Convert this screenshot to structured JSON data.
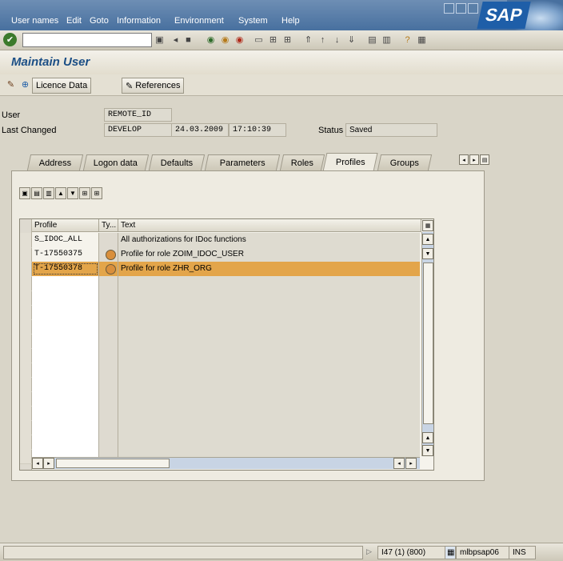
{
  "menu": {
    "items": [
      "User names",
      "Edit",
      "Goto",
      "Information",
      "Environment",
      "System",
      "Help"
    ],
    "logo": "SAP"
  },
  "toolbar": {
    "ok_symbol": "✔"
  },
  "screen": {
    "title": "Maintain User",
    "app_buttons": {
      "licence": "Licence Data",
      "references": "References"
    }
  },
  "header": {
    "user_label": "User",
    "user_value": "REMOTE_ID",
    "changed_label": "Last Changed",
    "changed_by": "DEVELOP",
    "changed_date": "24.03.2009",
    "changed_time": "17:10:39",
    "status_label": "Status",
    "status_value": "Saved"
  },
  "tabs": [
    {
      "label": "Address",
      "active": false
    },
    {
      "label": "Logon data",
      "active": false
    },
    {
      "label": "Defaults",
      "active": false
    },
    {
      "label": "Parameters",
      "active": false
    },
    {
      "label": "Roles",
      "active": false
    },
    {
      "label": "Profiles",
      "active": true
    },
    {
      "label": "Groups",
      "active": false
    }
  ],
  "table": {
    "columns": [
      "Profile",
      "Ty...",
      "Text"
    ],
    "rows": [
      {
        "profile": "S_IDOC_ALL",
        "type": "",
        "text": "All authorizations for IDoc functions",
        "selected": false
      },
      {
        "profile": "T-17550375",
        "type": "role",
        "text": "Profile for role ZOIM_IDOC_USER",
        "selected": false
      },
      {
        "profile": "T-17550378",
        "type": "role",
        "text": "Profile for role ZHR_ORG",
        "selected": true
      }
    ],
    "empty_rows": 13
  },
  "status_bar": {
    "session": "I47 (1) (800)",
    "server": "mlbpsap06",
    "mode": "INS"
  },
  "colors": {
    "menu_bg": "#48709f",
    "title_color": "#1c4f86",
    "highlight_row": "#e3a54a",
    "background": "#d9d5c8"
  }
}
